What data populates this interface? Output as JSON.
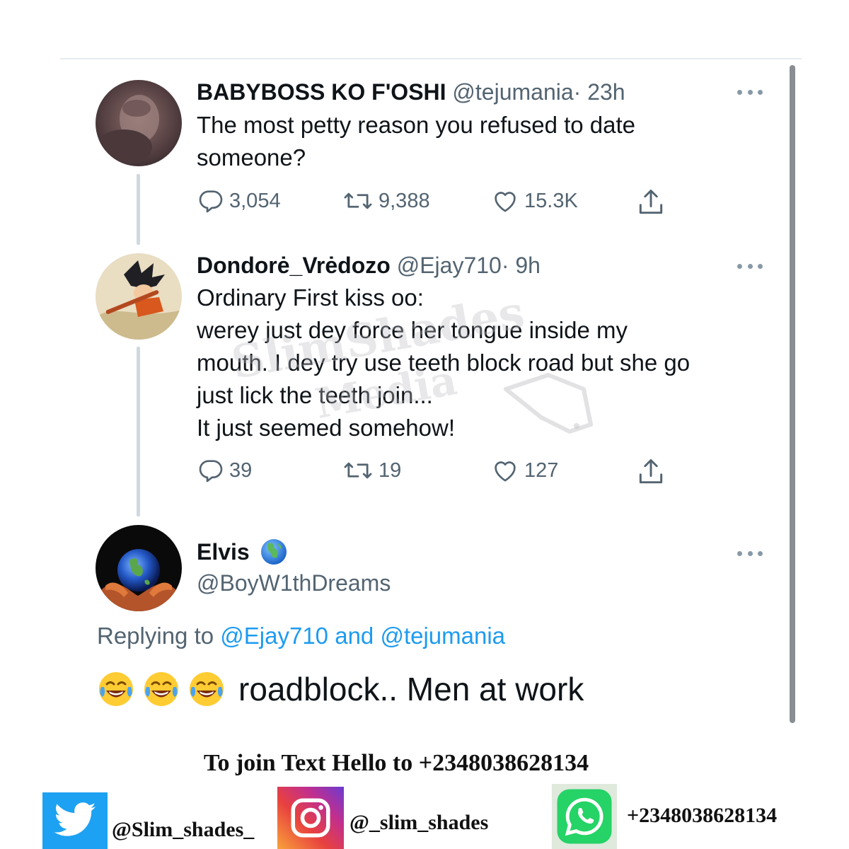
{
  "thread": [
    {
      "name": "BABYBOSS KO F'OSHI",
      "handle": "@tejumania",
      "separator": "·",
      "time": "23h",
      "text_lines": [
        "The most petty reason you refused to date",
        "someone?"
      ],
      "replies": "3,054",
      "retweets": "9,388",
      "likes": "15.3K"
    },
    {
      "name": "Dondorė_Vrėdozo",
      "handle": "@Ejay710",
      "separator": "·",
      "time": "9h",
      "text_lines": [
        "Ordinary First kiss oo:",
        "werey just dey force her tongue inside my",
        "mouth. I dey try use teeth block road but she go",
        "just lick the teeth join...",
        "It just seemed somehow!"
      ],
      "replies": "39",
      "retweets": "19",
      "likes": "127"
    }
  ],
  "focused": {
    "name": "Elvis",
    "name_emoji": "globe-europe-africa-icon",
    "handle": "@BoyW1thDreams",
    "replying_label": "Replying to",
    "mention_1": "@Ejay710",
    "and_label": "and",
    "mention_2": "@tejumania",
    "emoji": "face-with-tears-of-joy-icon",
    "emoji_count": 3,
    "text": "roadblock.. Men at work"
  },
  "watermark": {
    "line1": "SlimShades",
    "line2": "Media"
  },
  "footer": {
    "join_text": "To join Text Hello to +2348038628134",
    "twitter_handle": "@Slim_shades_",
    "instagram_handle": "@_slim_shades",
    "whatsapp_number": "+2348038628134"
  },
  "colors": {
    "accent": "#1d9bf0",
    "muted": "#536471",
    "thread_line": "#cfd9de",
    "twitter_brand": "#1da1f2",
    "whatsapp_brand": "#25d366"
  }
}
